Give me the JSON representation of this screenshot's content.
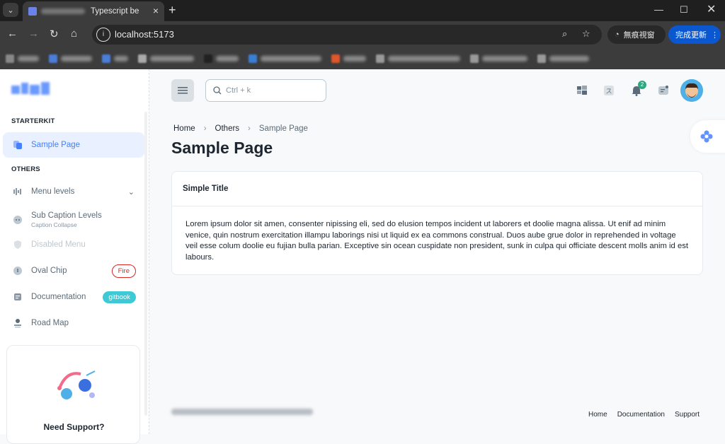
{
  "browser": {
    "tab_title": "Typescript be",
    "url": "localhost:5173",
    "incognito_label": "無痕視窗",
    "update_label": "完成更新",
    "colors": {
      "tabbar": "#1f1f1f",
      "toolbar": "#3c3c3c",
      "update": "#0b57d0"
    }
  },
  "sidebar": {
    "caption_starterkit": "STARTERKIT",
    "caption_others": "OTHERS",
    "items": [
      {
        "label": "Sample Page",
        "icon": "sample-page-icon",
        "active": true
      },
      {
        "label": "Menu levels",
        "icon": "menu-levels-icon"
      },
      {
        "label": "Sub Caption Levels",
        "sub": "Caption Collapse",
        "icon": "sub-caption-icon"
      },
      {
        "label": "Disabled Menu",
        "icon": "shield-icon"
      },
      {
        "label": "Oval Chip",
        "icon": "info-icon",
        "chip": "Fire"
      },
      {
        "label": "Documentation",
        "icon": "document-icon",
        "chip": "gitbook"
      },
      {
        "label": "Road Map",
        "icon": "road-map-icon"
      }
    ],
    "support_title": "Need Support?"
  },
  "header": {
    "search_placeholder": "Ctrl + k",
    "notification_count": "2"
  },
  "breadcrumb": {
    "home": "Home",
    "others": "Others",
    "current": "Sample Page"
  },
  "page_title": "Sample Page",
  "card": {
    "title": "Simple Title",
    "body": "Lorem ipsum dolor sit amen, consenter nipissing eli, sed do elusion tempos incident ut laborers et doolie magna alissa. Ut enif ad minim venice, quin nostrum exercitation illampu laborings nisi ut liquid ex ea commons construal. Duos aube grue dolor in reprehended in voltage veil esse colum doolie eu fujian bulla parian. Exceptive sin ocean cuspidate non president, sunk in culpa qui officiate descent molls anim id est labours."
  },
  "footer": {
    "links": [
      "Home",
      "Documentation",
      "Support"
    ]
  },
  "colors": {
    "primary": "#4680ff",
    "danger": "#dc2626",
    "info": "#3ec9d6",
    "success": "#2ca87f"
  }
}
